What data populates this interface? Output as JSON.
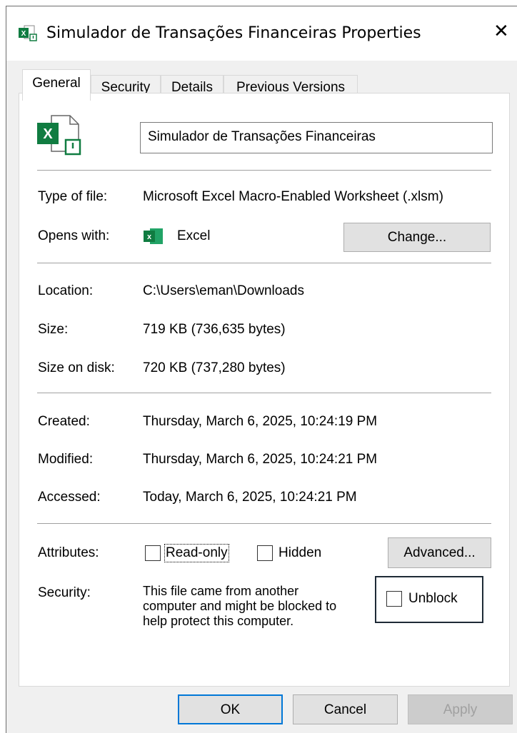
{
  "window": {
    "title": "Simulador de Transações Financeiras Properties",
    "close_glyph": "✕"
  },
  "tabs": [
    {
      "label": "General",
      "active": true
    },
    {
      "label": "Security",
      "active": false
    },
    {
      "label": "Details",
      "active": false
    },
    {
      "label": "Previous Versions",
      "active": false
    }
  ],
  "general": {
    "file_name": "Simulador de Transações Financeiras",
    "type_label": "Type of file:",
    "type_value": "Microsoft Excel Macro-Enabled Worksheet (.xlsm)",
    "opens_label": "Opens with:",
    "opens_value": "Excel",
    "change_button": "Change...",
    "location_label": "Location:",
    "location_value": "C:\\Users\\eman\\Downloads",
    "size_label": "Size:",
    "size_value": "719 KB (736,635 bytes)",
    "size_disk_label": "Size on disk:",
    "size_disk_value": "720 KB (737,280 bytes)",
    "created_label": "Created:",
    "created_value": "Thursday, March 6, 2025, 10:24:19 PM",
    "modified_label": "Modified:",
    "modified_value": "Thursday, March 6, 2025, 10:24:21 PM",
    "accessed_label": "Accessed:",
    "accessed_value": "Today, March 6, 2025, 10:24:21 PM",
    "attributes_label": "Attributes:",
    "readonly_label": "Read-only",
    "readonly_checked": false,
    "hidden_label": "Hidden",
    "hidden_checked": false,
    "advanced_button": "Advanced...",
    "security_label": "Security:",
    "security_line1": "This file came from another",
    "security_line2": "computer and might be blocked to",
    "security_line3": "help protect this computer.",
    "unblock_label": "Unblock",
    "unblock_checked": false
  },
  "footer": {
    "ok": "OK",
    "cancel": "Cancel",
    "apply": "Apply"
  },
  "colors": {
    "excel_green": "#107c41",
    "focus_blue": "#0078d7",
    "dialog_bg": "#f0f0f0"
  },
  "icons": {
    "app_icon": "excel-macro-file-icon",
    "large_file_icon": "excel-macro-file-icon",
    "opens_with_icon": "excel-icon",
    "close": "close-icon"
  }
}
